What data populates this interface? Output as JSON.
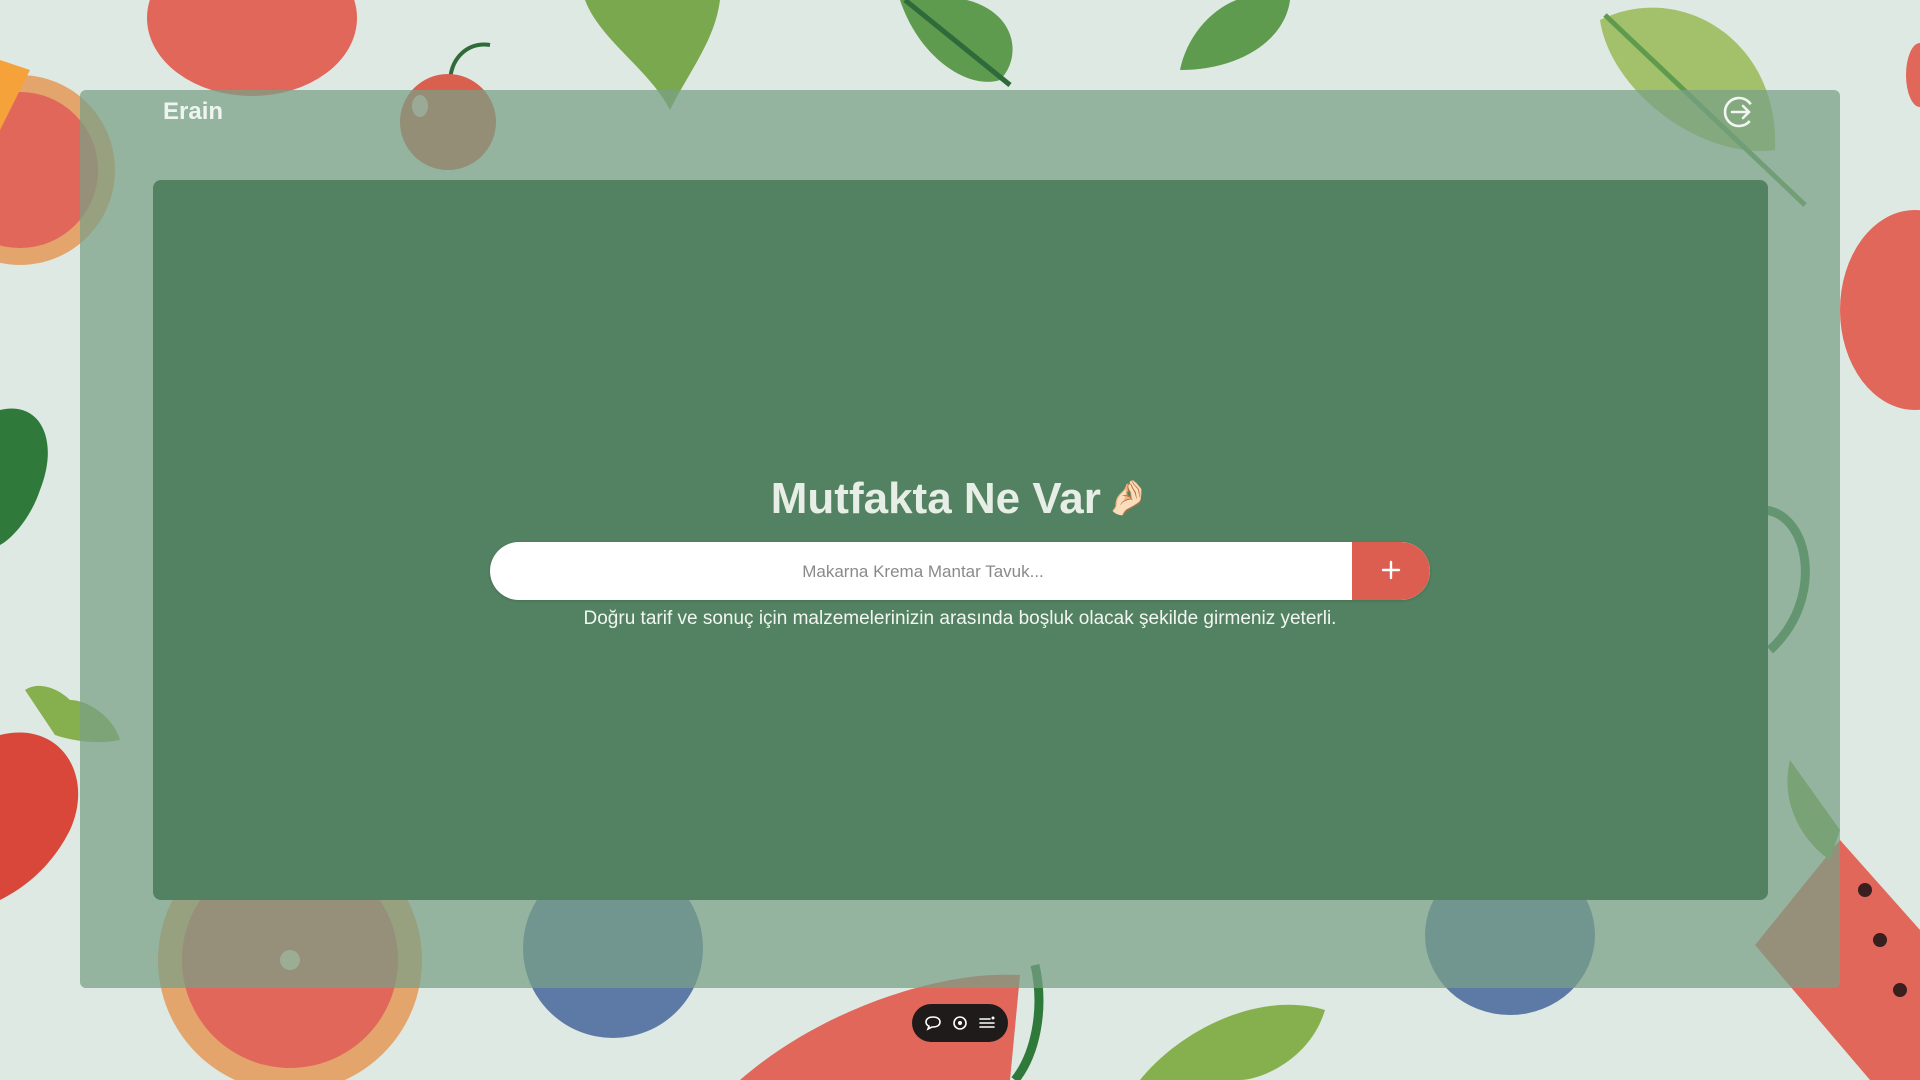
{
  "header": {
    "brand": "Erain",
    "logout_icon": "logout-icon"
  },
  "main": {
    "title": "Mutfakta Ne Var",
    "title_emoji": "🤌🏻",
    "search": {
      "placeholder": "Makarna Krema Mantar Tavuk...",
      "value": ""
    },
    "add_button_icon": "plus-icon",
    "hint": "Doğru tarif ve sonuç için malzemelerinizin arasında boşluk olacak şekilde girmeniz yeterli."
  },
  "floating_toolbar": {
    "icons": [
      "chat-icon",
      "eye-icon",
      "menu-icon"
    ]
  },
  "colors": {
    "accent": "#dc5e50",
    "panel": "#538262",
    "overlay": "#78a087"
  }
}
